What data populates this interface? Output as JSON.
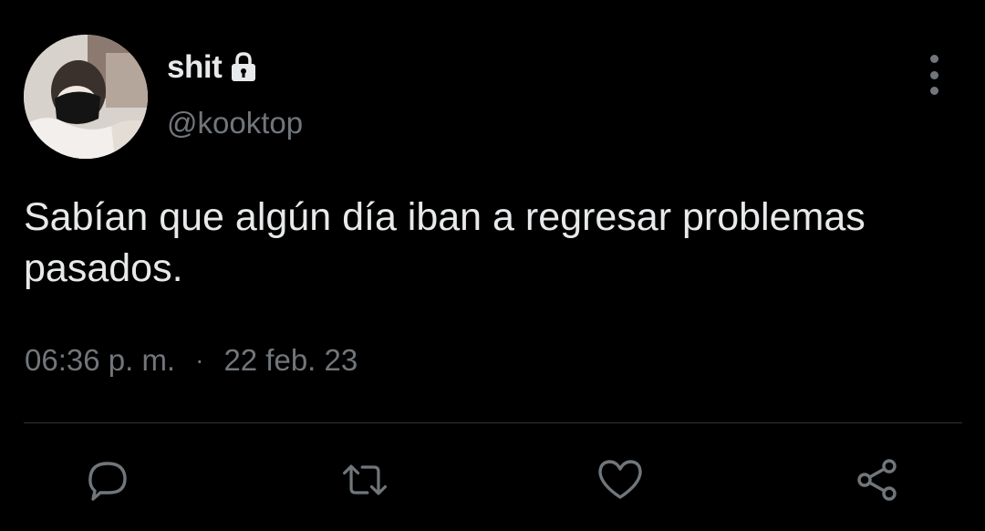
{
  "user": {
    "display_name": "shit",
    "handle": "@kooktop",
    "protected_icon": "lock-icon",
    "avatar_icon": "avatar-photo"
  },
  "tweet": {
    "text_line_1": "Sabían que algún día iban a regresar problemas",
    "text_line_2": "pasados.",
    "time": "06:36 p. m.",
    "separator": "·",
    "date": "22 feb. 23"
  },
  "actions": {
    "reply_icon": "reply-icon",
    "retweet_icon": "retweet-icon",
    "like_icon": "heart-icon",
    "share_icon": "share-icon",
    "more_icon": "more-vertical-icon"
  },
  "colors": {
    "background": "#000000",
    "primary_text": "#e7e9ea",
    "secondary_text": "#71767b",
    "divider": "#2f3336"
  }
}
